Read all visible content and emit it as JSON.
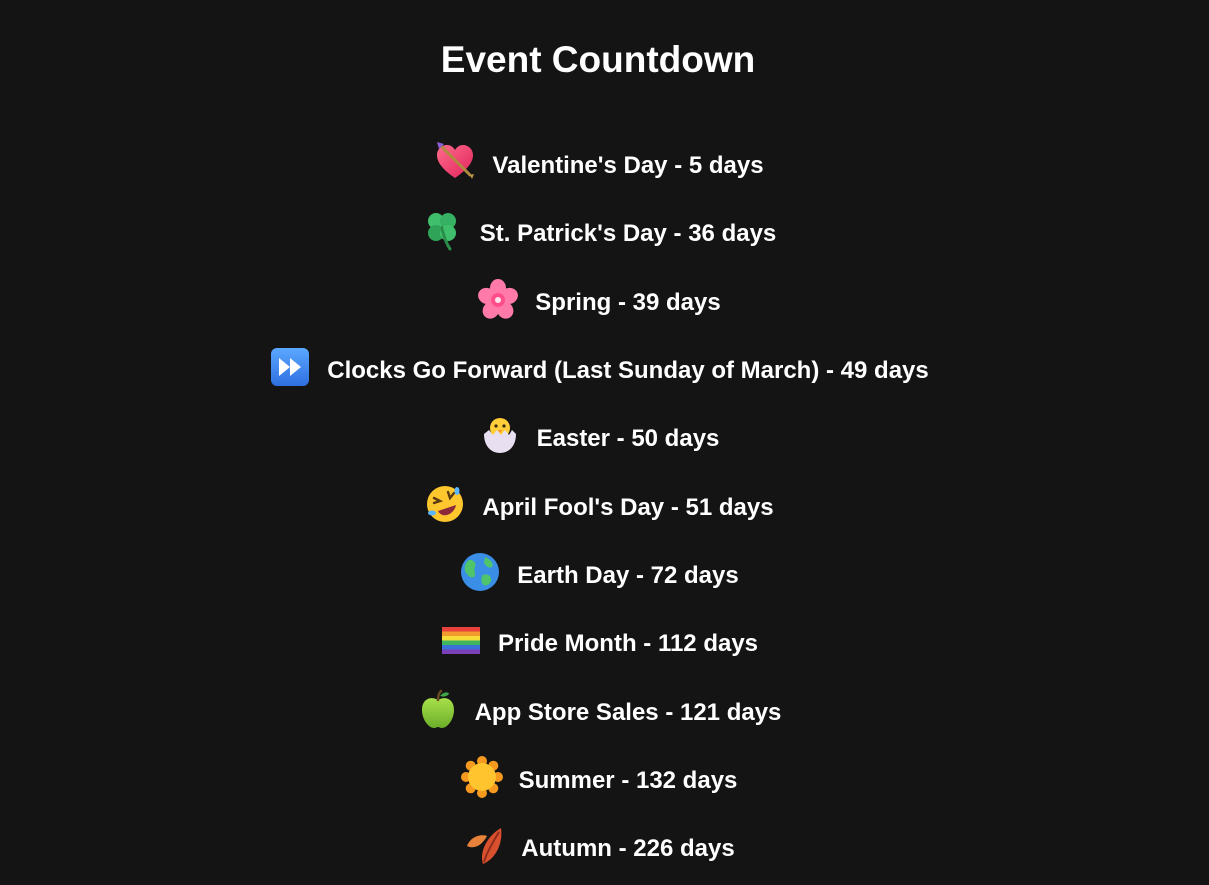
{
  "page": {
    "title": "Event Countdown"
  },
  "colors": {
    "background": "#141414",
    "text": "#ffffff"
  },
  "events": [
    {
      "icon": "heart-with-arrow-icon",
      "text": "Valentine's Day - 5 days"
    },
    {
      "icon": "four-leaf-clover-icon",
      "text": "St. Patrick's Day - 36 days"
    },
    {
      "icon": "cherry-blossom-icon",
      "text": "Spring - 39 days"
    },
    {
      "icon": "fast-forward-icon",
      "text": "Clocks Go Forward (Last Sunday of March) - 49 days"
    },
    {
      "icon": "hatching-chick-icon",
      "text": "Easter - 50 days"
    },
    {
      "icon": "rolling-laughing-face-icon",
      "text": "April Fool's Day - 51 days"
    },
    {
      "icon": "globe-icon",
      "text": "Earth Day - 72 days"
    },
    {
      "icon": "rainbow-flag-icon",
      "text": "Pride Month - 112 days"
    },
    {
      "icon": "green-apple-icon",
      "text": "App Store Sales - 121 days"
    },
    {
      "icon": "sun-icon",
      "text": "Summer - 132 days"
    },
    {
      "icon": "fallen-leaf-icon",
      "text": "Autumn - 226 days"
    }
  ]
}
